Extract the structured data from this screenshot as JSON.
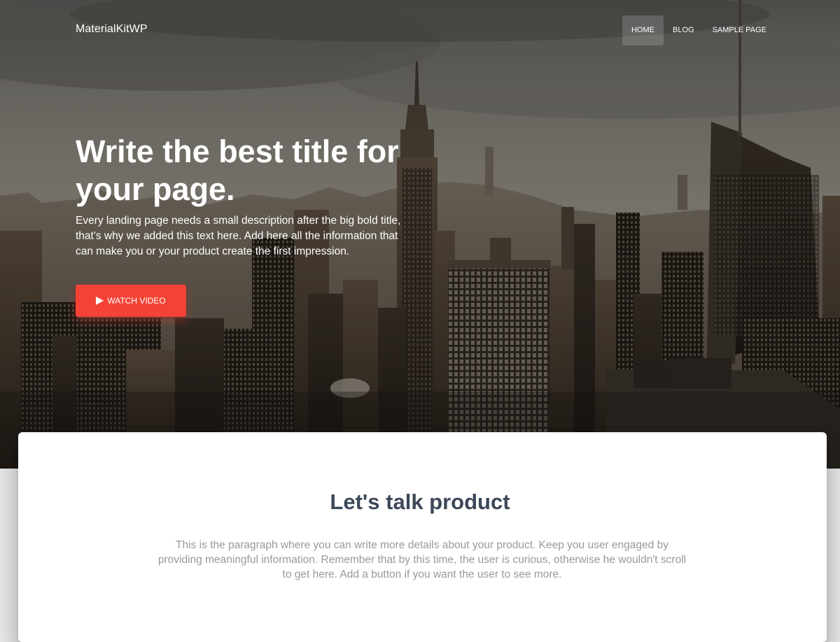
{
  "brand": {
    "name": "MaterialKitWP"
  },
  "nav": {
    "items": [
      {
        "label": "HOME",
        "active": true
      },
      {
        "label": "BLOG",
        "active": false
      },
      {
        "label": "SAMPLE PAGE",
        "active": false
      }
    ]
  },
  "hero": {
    "title": "Write the best title for your page.",
    "description": "Every landing page needs a small description after the big bold title, that's why we added this text here. Add here all the information that can make you or your product create the first impression.",
    "button": {
      "label": "WATCH VIDEO",
      "icon": "play-icon"
    },
    "background": "city-skyline-photo"
  },
  "product": {
    "title": "Let's talk product",
    "description": "This is the paragraph where you can write more details about your product. Keep you user engaged by providing meaningful information. Remember that by this time, the user is curious, otherwise he wouldn't scroll to get here. Add a button if you want the user to see more."
  },
  "colors": {
    "accent": "#f44336",
    "title": "#3c4858",
    "muted": "#999999"
  }
}
